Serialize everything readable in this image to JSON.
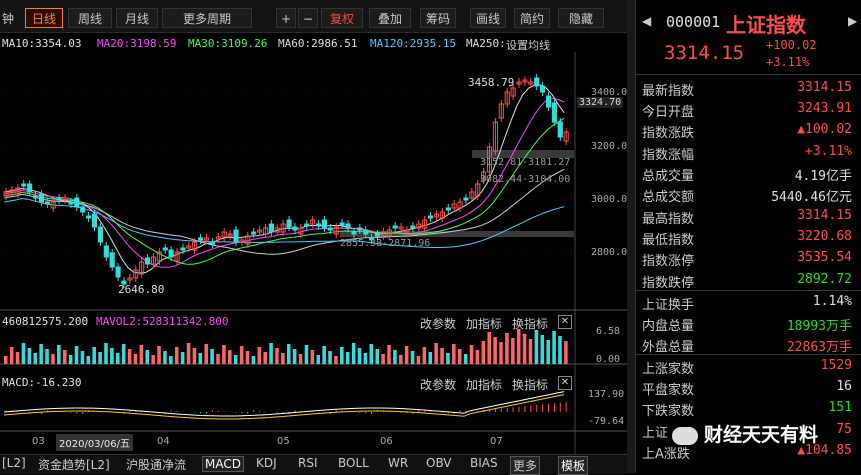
{
  "toolbar": {
    "partial_left": "钟",
    "periods": [
      "日线",
      "周线",
      "月线",
      "更多周期"
    ],
    "zoom_in": "+",
    "zoom_out": "−",
    "adjust": "复权",
    "overlay": "叠加",
    "chips": "筹码",
    "draw": "画线",
    "simple": "简约",
    "hide": "隐藏"
  },
  "ma_line": {
    "ma10": "MA10:3354.03",
    "ma20": "MA20:3198.59",
    "ma30": "MA30:3109.26",
    "ma60": "MA60:2986.51",
    "ma120": "MA120:2935.15",
    "ma250": "MA250:",
    "settings": "设置均线"
  },
  "chart_labels": {
    "high_label": "3458.79",
    "low_label": "2646.80",
    "cursor_price": "3324.70",
    "box1": "3152.81-3181.27",
    "box2": "3082.44-3104.00",
    "box3": "2855.38-2871.96"
  },
  "y_ticks": [
    "3400.00",
    "3200.00",
    "3000.00",
    "2800.00"
  ],
  "volume_panel": {
    "vol": "460812575.200",
    "mavol2": "MAVOL2:528311342.800",
    "change_params": "改参数",
    "add_indicator": "加指标",
    "switch_indicator": "换指标",
    "ticks": [
      "6.58",
      "0.00"
    ]
  },
  "macd_panel": {
    "macd": "MACD:-16.230",
    "change_params": "改参数",
    "add_indicator": "加指标",
    "switch_indicator": "换指标",
    "ticks": [
      "137.90",
      "-79.64"
    ]
  },
  "x_axis": {
    "labels": [
      "03",
      "04",
      "05",
      "06",
      "07"
    ],
    "date_box": "2020/03/06/五"
  },
  "bottom_tabs": [
    "[L2]",
    "资金趋势[L2]",
    "沪股通净流",
    "MACD",
    "KDJ",
    "RSI",
    "BOLL",
    "WR",
    "OBV",
    "BIAS",
    "更多",
    "模板"
  ],
  "panel": {
    "code": "000001",
    "name": "上证指数",
    "price": "3314.15",
    "change": "+100.02",
    "change_pct": "+3.11%",
    "rows": [
      {
        "k": "最新指数",
        "v": "3314.15",
        "c": "up"
      },
      {
        "k": "今日开盘",
        "v": "3243.91",
        "c": "up"
      },
      {
        "k": "指数涨跌",
        "v": "▲100.02",
        "c": "up"
      },
      {
        "k": "指数涨幅",
        "v": "+3.11%",
        "c": "up"
      },
      {
        "k": "总成交量",
        "v": "4.19亿手",
        "c": "wh"
      },
      {
        "k": "总成交额",
        "v": "5440.46亿元",
        "c": "wh"
      },
      {
        "k": "最高指数",
        "v": "3314.15",
        "c": "up"
      },
      {
        "k": "最低指数",
        "v": "3220.68",
        "c": "up"
      },
      {
        "k": "指数涨停",
        "v": "3535.54",
        "c": "up"
      },
      {
        "k": "指数跌停",
        "v": "2892.72",
        "c": "dn"
      },
      {
        "k": "上证换手",
        "v": "1.14%",
        "c": "wh"
      },
      {
        "k": "内盘总量",
        "v": "18993万手",
        "c": "dn"
      },
      {
        "k": "外盘总量",
        "v": "22863万手",
        "c": "up"
      },
      {
        "k": "上涨家数",
        "v": "1529",
        "c": "up"
      },
      {
        "k": "平盘家数",
        "v": "16",
        "c": "wh"
      },
      {
        "k": "下跌家数",
        "v": "151",
        "c": "dn"
      },
      {
        "k": "上证",
        "v": "75",
        "c": "up"
      },
      {
        "k": "上A涨跌",
        "v": "▲104.85",
        "c": "up"
      }
    ],
    "watermark": "财经天天有料"
  }
}
